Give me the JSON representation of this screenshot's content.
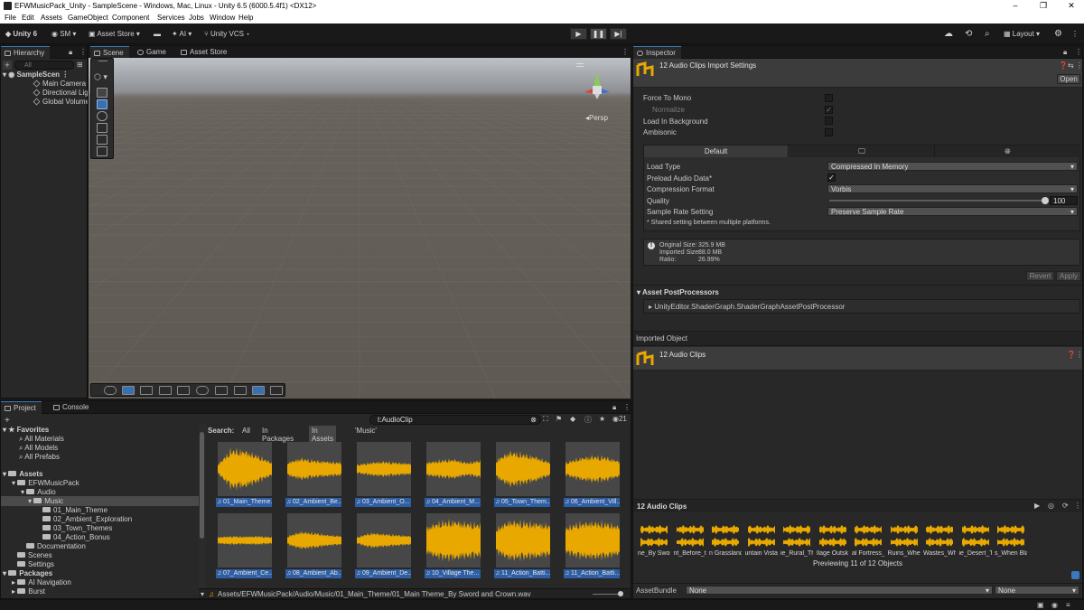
{
  "window": {
    "title": "EFWMusicPack_Unity - SampleScene - Windows, Mac, Linux - Unity 6.5 (6000.5.4f1) <DX12>",
    "controls": [
      "–",
      "❐",
      "✕"
    ]
  },
  "menu": [
    "File",
    "Edit",
    "Assets",
    "GameObject",
    "Component",
    "Services",
    "Jobs",
    "Window",
    "Help"
  ],
  "toolbar": {
    "unity_label": "Unity 6",
    "account": "SM",
    "asset_store": "Asset Store",
    "ai": "AI",
    "vcs": "Unity VCS",
    "layout": "Layout"
  },
  "hierarchy": {
    "tab": "Hierarchy",
    "search_placeholder": "All",
    "scene": "SampleScen",
    "items": [
      "Main Camera",
      "Directional Lig",
      "Global Volume"
    ]
  },
  "scene": {
    "tabs": [
      "Scene",
      "Game",
      "Asset Store"
    ],
    "persp": "◂Persp"
  },
  "project": {
    "tabs": [
      "Project",
      "Console"
    ],
    "search_value": "t:AudioClip",
    "hidden_count": "21",
    "search_label": "Search:",
    "filters": [
      "All",
      "In Packages",
      "In Assets",
      "'Music'"
    ],
    "favorites": {
      "label": "Favorites",
      "items": [
        "All Materials",
        "All Models",
        "All Prefabs"
      ]
    },
    "assets_label": "Assets",
    "tree": [
      {
        "label": "EFWMusicPack",
        "depth": 1
      },
      {
        "label": "Audio",
        "depth": 2
      },
      {
        "label": "Music",
        "depth": 3
      },
      {
        "label": "01_Main_Theme",
        "depth": 4
      },
      {
        "label": "02_Ambient_Exploration",
        "depth": 4
      },
      {
        "label": "03_Town_Themes",
        "depth": 4
      },
      {
        "label": "04_Action_Bonus",
        "depth": 4
      },
      {
        "label": "Documentation",
        "depth": 2
      },
      {
        "label": "Scenes",
        "depth": 1
      },
      {
        "label": "Settings",
        "depth": 1
      }
    ],
    "packages_label": "Packages",
    "packages": [
      "AI Navigation",
      "Burst"
    ],
    "clips": [
      "01_Main_Theme...",
      "02_Ambient_Be...",
      "03_Ambient_O...",
      "04_Ambient_M...",
      "05_Town_Them...",
      "06_Ambient_Vill...",
      "07_Ambient_Ce...",
      "08_Ambient_Ab...",
      "09_Ambient_De...",
      "10_Village The...",
      "11_Action_Batti...",
      "11_Action_Batti..."
    ],
    "path": "Assets/EFWMusicPack/Audio/Music/01_Main_Theme/01_Main Theme_By Sword and Crown.wav"
  },
  "inspector": {
    "tab": "Inspector",
    "header_title": "12 Audio Clips Import Settings",
    "open_button": "Open",
    "force_to_mono": "Force To Mono",
    "normalize": "Normalize",
    "load_in_background": "Load In Background",
    "ambisonic": "Ambisonic",
    "platform_tab_default": "Default",
    "load_type_label": "Load Type",
    "load_type_value": "Compressed In Memory",
    "preload_label": "Preload Audio Data*",
    "compression_label": "Compression Format",
    "compression_value": "Vorbis",
    "quality_label": "Quality",
    "quality_value": "100",
    "sample_rate_label": "Sample Rate Setting",
    "sample_rate_value": "Preserve Sample Rate",
    "shared_note": "* Shared setting between multiple platforms.",
    "original_size_label": "Original Size:",
    "original_size": "325.9 MB",
    "imported_size_label": "Imported Size:",
    "imported_size": "88.0 MB",
    "ratio_label": "Ratio:",
    "ratio": "26.99%",
    "revert": "Revert",
    "apply": "Apply",
    "postprocessors_title": "Asset PostProcessors",
    "postprocessor_item": "UnityEditor.ShaderGraph.ShaderGraphAssetPostProcessor",
    "imported_object_title": "Imported Object",
    "imported_object_name": "12 Audio Clips",
    "preview_title": "12 Audio Clips",
    "preview_labels": [
      "ne_By Swor",
      "nt_Before_th",
      "n Grassland",
      "untain Vista_",
      "ie_Rural_Th",
      "llage Outsk",
      "al Fortress_",
      "Ruins_When",
      "Wastes_Whe",
      "ie_Desert_T",
      "s_When Blac"
    ],
    "previewing": "Previewing 11 of 12 Objects",
    "assetbundle_label": "AssetBundle",
    "assetbundle_value": "None",
    "assetbundle_variant": "None"
  },
  "colors": {
    "accent": "#3a79bb",
    "waveform": "#e8a800",
    "selection": "#2e5ea3"
  }
}
